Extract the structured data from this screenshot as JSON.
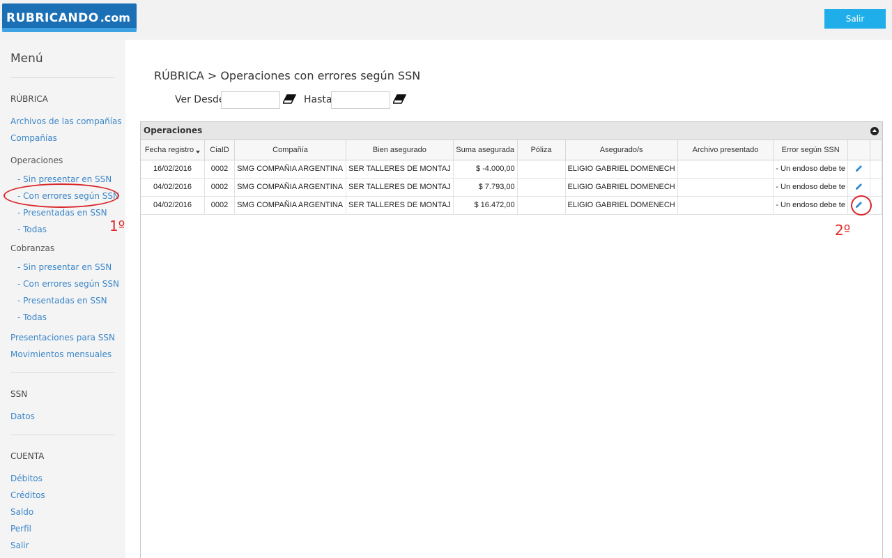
{
  "header": {
    "logo_main": "RUBRICANDO",
    "logo_suffix": ".com",
    "logout_label": "Salir"
  },
  "sidebar": {
    "menu_title": "Menú",
    "rubrica_section": "RÚBRICA",
    "archivos": "Archivos de las compañías",
    "companias": "Compañías",
    "operaciones_group": "Operaciones",
    "op_sin_presentar": "- Sin presentar en SSN",
    "op_con_errores": "- Con errores según SSN",
    "op_presentadas": "- Presentadas en SSN",
    "op_todas": "- Todas",
    "cobranzas_group": "Cobranzas",
    "cob_sin_presentar": "- Sin presentar en SSN",
    "cob_con_errores": "- Con errores según SSN",
    "cob_presentadas": "- Presentadas en SSN",
    "cob_todas": "- Todas",
    "presentaciones": "Presentaciones para SSN",
    "movimientos": "Movimientos mensuales",
    "ssn_section": "SSN",
    "datos": "Datos",
    "cuenta_section": "CUENTA",
    "debitos": "Débitos",
    "creditos": "Créditos",
    "saldo": "Saldo",
    "perfil": "Perfil",
    "salir": "Salir"
  },
  "annotations": {
    "step1": "1º",
    "step2": "2º"
  },
  "main": {
    "breadcrumb": "RÚBRICA > Operaciones con errores según SSN",
    "filter_from_label": "Ver Desde",
    "filter_to_label": "Hasta",
    "filter_from_value": "",
    "filter_to_value": ""
  },
  "panel": {
    "title": "Operaciones",
    "columns": [
      "Fecha registro",
      "CiaID",
      "Compañía",
      "Bien asegurado",
      "Suma asegurada",
      "Póliza",
      "Asegurado/s",
      "Archivo presentado",
      "Error según SSN"
    ],
    "rows": [
      [
        "16/02/2016",
        "0002",
        "SMG COMPAÑIA ARGENTINA",
        "SER TALLERES DE MONTAJ",
        "$ -4.000,00",
        "",
        "ELIGIO GABRIEL DOMENECH",
        "",
        "- Un endoso debe te"
      ],
      [
        "04/02/2016",
        "0002",
        "SMG COMPAÑIA ARGENTINA",
        "SER TALLERES DE MONTAJ",
        "$ 7.793,00",
        "",
        "ELIGIO GABRIEL DOMENECH",
        "",
        "- Un endoso debe te"
      ],
      [
        "04/02/2016",
        "0002",
        "SMG COMPAÑIA ARGENTINA",
        "SER TALLERES DE MONTAJ",
        "$ 16.472,00",
        "",
        "ELIGIO GABRIEL DOMENECH",
        "",
        "- Un endoso debe te"
      ]
    ]
  },
  "colors": {
    "brand_blue": "#1a6fb5",
    "accent_cyan": "#1faee9",
    "link_blue": "#3b86c8",
    "annotation_red": "#d8262a"
  }
}
